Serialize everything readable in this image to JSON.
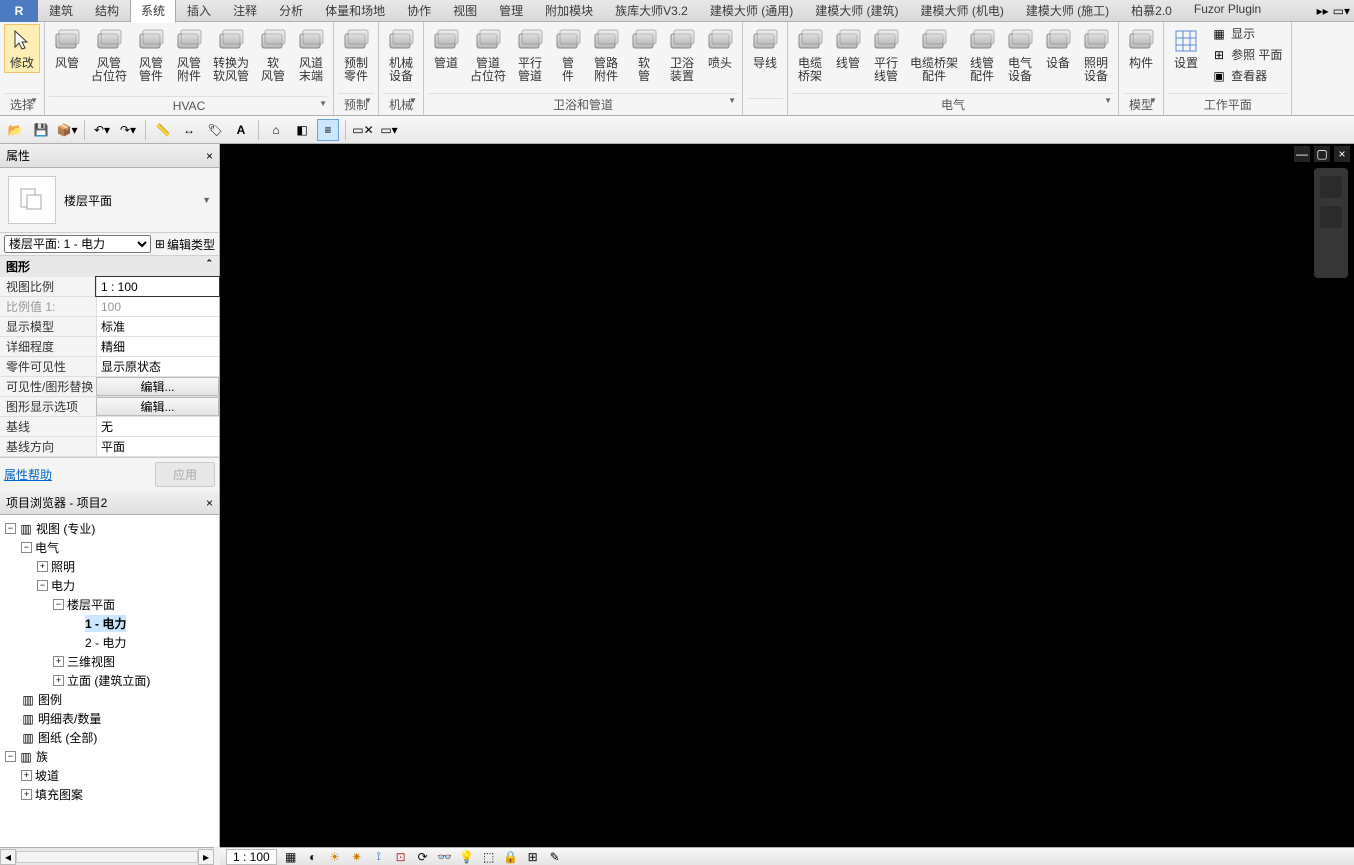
{
  "tabs": [
    "建筑",
    "结构",
    "系统",
    "插入",
    "注释",
    "分析",
    "体量和场地",
    "协作",
    "视图",
    "管理",
    "附加模块",
    "族库大师V3.2",
    "建模大师 (通用)",
    "建模大师 (建筑)",
    "建模大师 (机电)",
    "建模大师 (施工)",
    "柏慕2.0",
    "Fuzor Plugin"
  ],
  "active_tab": 2,
  "ribbon": {
    "select": {
      "modify": "修改",
      "title": "选择"
    },
    "hvac": {
      "title": "HVAC",
      "items": [
        "风管",
        "风管\n占位符",
        "风管\n管件",
        "风管\n附件",
        "转换为\n软风管",
        "软\n风管",
        "风道\n末端"
      ]
    },
    "prefab": {
      "title": "预制",
      "items": [
        "预制\n零件"
      ]
    },
    "mech": {
      "title": "机械",
      "items": [
        "机械\n设备"
      ]
    },
    "plumb": {
      "title": "卫浴和管道",
      "items": [
        "管道",
        "管道\n占位符",
        "平行\n管道",
        "管\n件",
        "管路\n附件",
        "软\n管",
        "卫浴\n装置",
        "喷头"
      ]
    },
    "wire": {
      "items": [
        "导线"
      ]
    },
    "elec": {
      "title": "电气",
      "items": [
        "电缆\n桥架",
        "线管",
        "平行\n线管",
        "电缆桥架\n配件",
        "线管\n配件",
        "电气\n设备",
        "设备",
        "照明\n设备"
      ]
    },
    "model": {
      "title": "模型",
      "items": [
        "构件"
      ]
    },
    "workplane": {
      "title": "工作平面",
      "big": "设置",
      "small": [
        "显示",
        "参照 平面",
        "查看器"
      ]
    }
  },
  "panel_props": "属性",
  "floorplan_name": "楼层平面",
  "type_selector": "楼层平面: 1 - 电力",
  "edit_type": "编辑类型",
  "props_section": "图形",
  "props_rows": [
    {
      "k": "视图比例",
      "v": "1 : 100",
      "sel": true
    },
    {
      "k": "比例值 1:",
      "v": "100",
      "dim": true
    },
    {
      "k": "显示模型",
      "v": "标准"
    },
    {
      "k": "详细程度",
      "v": "精细"
    },
    {
      "k": "零件可见性",
      "v": "显示原状态"
    },
    {
      "k": "可见性/图形替换",
      "v": "编辑...",
      "btn": true
    },
    {
      "k": "图形显示选项",
      "v": "编辑...",
      "btn": true
    },
    {
      "k": "基线",
      "v": "无"
    },
    {
      "k": "基线方向",
      "v": "平面"
    }
  ],
  "props_help": "属性帮助",
  "apply": "应用",
  "browser_title": "项目浏览器 - 项目2",
  "tree": [
    {
      "d": 0,
      "tw": "-",
      "ic": "o",
      "t": "视图 (专业)"
    },
    {
      "d": 1,
      "tw": "-",
      "t": "电气"
    },
    {
      "d": 2,
      "tw": "+",
      "t": "照明"
    },
    {
      "d": 2,
      "tw": "-",
      "t": "电力"
    },
    {
      "d": 3,
      "tw": "-",
      "t": "楼层平面"
    },
    {
      "d": 4,
      "t": "1 - 电力",
      "sel": true
    },
    {
      "d": 4,
      "t": "2 - 电力"
    },
    {
      "d": 3,
      "tw": "+",
      "t": "三维视图"
    },
    {
      "d": 3,
      "tw": "+",
      "t": "立面 (建筑立面)"
    },
    {
      "d": 0,
      "ic": "leg",
      "t": "图例"
    },
    {
      "d": 0,
      "ic": "sch",
      "t": "明细表/数量"
    },
    {
      "d": 0,
      "ic": "sht",
      "t": "图纸 (全部)"
    },
    {
      "d": 0,
      "tw": "-",
      "ic": "fam",
      "t": "族"
    },
    {
      "d": 1,
      "tw": "+",
      "t": "坡道"
    },
    {
      "d": 1,
      "tw": "+",
      "t": "填充图案"
    }
  ],
  "viewbar_scale": "1 : 100"
}
